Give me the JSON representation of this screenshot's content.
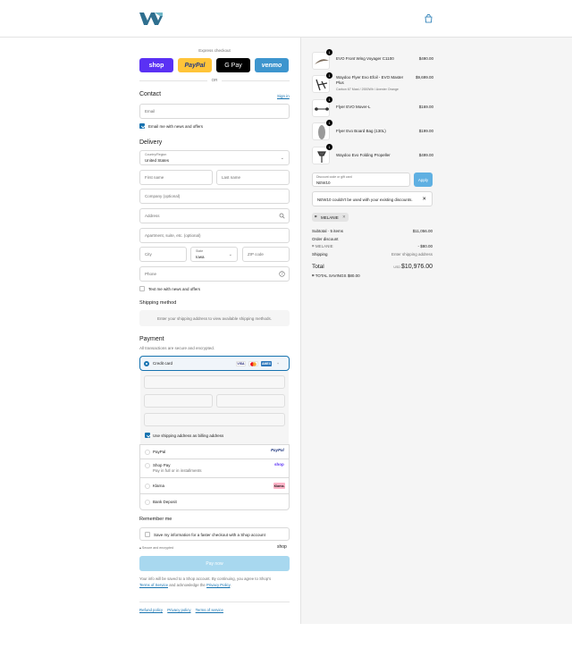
{
  "header": {
    "logo_name": "brand-logo",
    "cart_icon": "shopping-bag-icon"
  },
  "express": {
    "label": "Express checkout",
    "buttons": {
      "shop": "shop",
      "paypal": "PayPal",
      "gpay": "G Pay",
      "venmo": "venmo"
    },
    "or": "OR"
  },
  "contact": {
    "title": "Contact",
    "sign_in": "Sign in",
    "email_placeholder": "Email",
    "news_label": "Email me with news and offers",
    "news_checked": true
  },
  "delivery": {
    "title": "Delivery",
    "country_label": "Country/Region",
    "country_value": "United States",
    "first_name": "First name",
    "last_name": "Last name",
    "company": "Company (optional)",
    "address": "Address",
    "apartment": "Apartment, suite, etc. (optional)",
    "city": "City",
    "state_label": "State",
    "state_value": "Iowa",
    "zip": "ZIP code",
    "phone": "Phone",
    "text_news": "Text me with news and offers"
  },
  "shipping_method": {
    "title": "Shipping method",
    "message": "Enter your shipping address to view available shipping methods."
  },
  "payment": {
    "title": "Payment",
    "subtitle": "All transactions are secure and encrypted.",
    "credit_card": "Credit card",
    "card_brands": [
      "VISA",
      "MC",
      "AMEX"
    ],
    "billing_same": "Use shipping address as billing address",
    "options": {
      "paypal": "PayPal",
      "paypal_logo": "PayPal",
      "shop_pay": "Shop Pay",
      "shop_pay_sub": "Pay in full or in installments",
      "shop_logo": "shop",
      "klarna": "Klarna",
      "klarna_logo": "Klarna.",
      "bank": "Bank Deposit"
    }
  },
  "remember": {
    "title": "Remember me",
    "save_label": "Save my information for a faster checkout with a Shop account",
    "secure": "Secure and encrypted",
    "shop_logo": "shop"
  },
  "pay_now": "Pay now",
  "legal": {
    "text": "Your info will be saved to a Shop account. By continuing, you agree to Shop's",
    "terms": "Terms of Service",
    "and": "and acknowledge the",
    "privacy": "Privacy Policy"
  },
  "footer": {
    "refund": "Refund policy",
    "privacy": "Privacy policy",
    "terms": "Terms of service"
  },
  "cart": {
    "items": [
      {
        "name": "EVO Front Wing Voyager C1100",
        "sub": "",
        "price": "$490.00",
        "qty": "1"
      },
      {
        "name": "Waydoo Flyer Evo Efoil - EVO Master Plus",
        "sub": "Carbon 67 Mast / 2000Wh / Avenier Orange",
        "price": "$9,699.00",
        "qty": "1"
      },
      {
        "name": "Flyer EVO Mover-L",
        "sub": "",
        "price": "$169.00",
        "qty": "1"
      },
      {
        "name": "Flyer Evo Board Bag (130L)",
        "sub": "",
        "price": "$199.00",
        "qty": "1"
      },
      {
        "name": "Waydoo Evo Folding Propeller",
        "sub": "",
        "price": "$499.00",
        "qty": "1"
      }
    ],
    "discount_label": "Discount code or gift card",
    "discount_value": "NEW10",
    "apply": "Apply",
    "error": "NEW10 couldn't be used with your existing discounts.",
    "tag": "MELANIE",
    "subtotal_label": "Subtotal · 5 items",
    "subtotal": "$11,056.00",
    "order_discount": "Order discount",
    "discount_code": "MELANIE",
    "discount_amount": "- $80.00",
    "shipping_label": "Shipping",
    "shipping_value": "Enter shipping address",
    "total_label": "Total",
    "currency": "USD",
    "total": "$10,976.00",
    "savings_label": "TOTAL SAVINGS",
    "savings": "$80.00"
  },
  "colors": {
    "accent": "#1773b0",
    "shop": "#5a31f4",
    "paypal": "#ffc439",
    "venmo": "#3d95ce",
    "pay_disabled": "#a8d8ef"
  }
}
